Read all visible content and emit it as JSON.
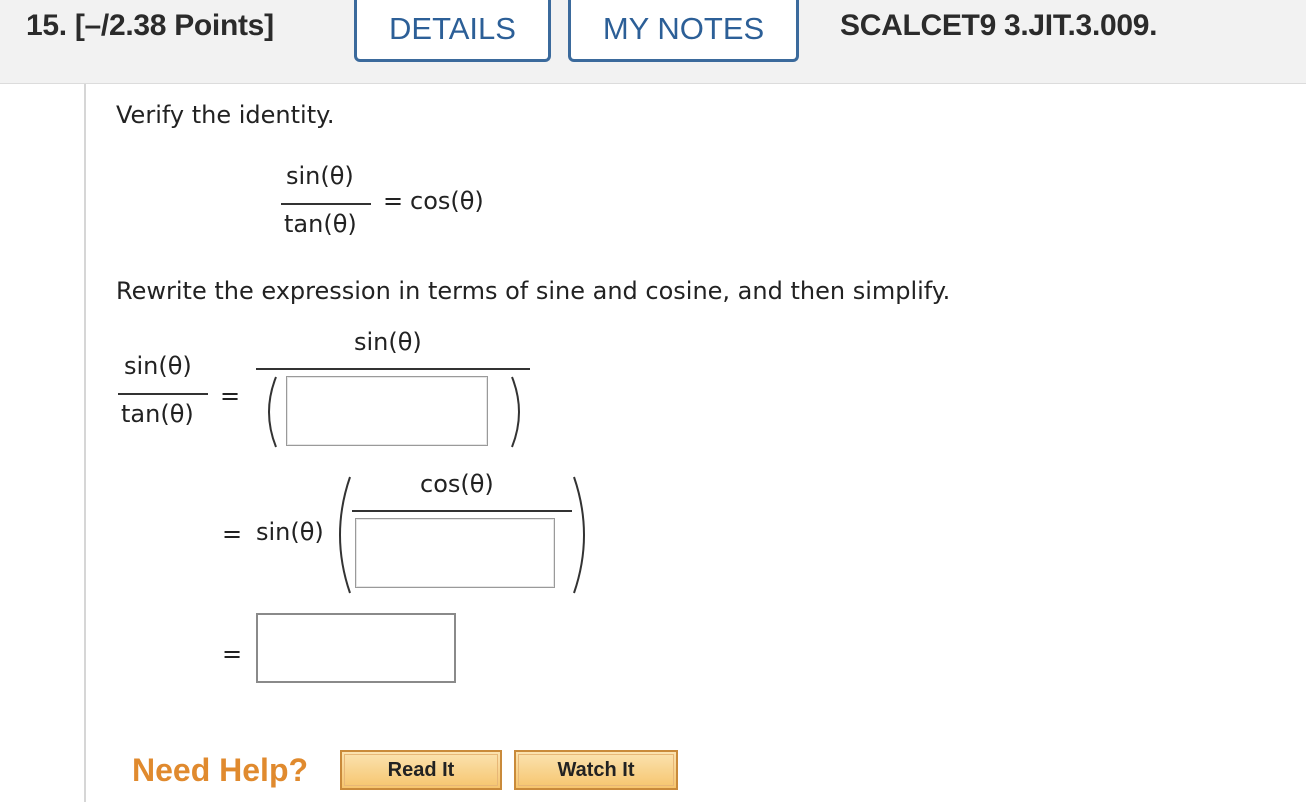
{
  "header": {
    "question_number": "15.",
    "points": "[–/2.38 Points]",
    "details_tab": "DETAILS",
    "notes_tab": "MY NOTES",
    "question_code": "SCALCET9 3.JIT.3.009."
  },
  "problem": {
    "instruction": "Verify the identity.",
    "identity": {
      "numerator": "sin(θ)",
      "denominator": "tan(θ)",
      "equals": "=",
      "rhs": "cos(θ)"
    },
    "rewrite_instruction": "Rewrite the expression in terms of sine and cosine, and then simplify.",
    "step1": {
      "lhs_numerator": "sin(θ)",
      "lhs_denominator": "tan(θ)",
      "equals": "=",
      "rhs_numerator": "sin(θ)",
      "input_value": ""
    },
    "step2": {
      "equals": "=",
      "factor": "sin(θ)",
      "inner_numerator": "cos(θ)",
      "input_value": ""
    },
    "step3": {
      "equals": "=",
      "input_value": ""
    }
  },
  "help": {
    "label": "Need Help?",
    "read_button": "Read It",
    "watch_button": "Watch It"
  }
}
